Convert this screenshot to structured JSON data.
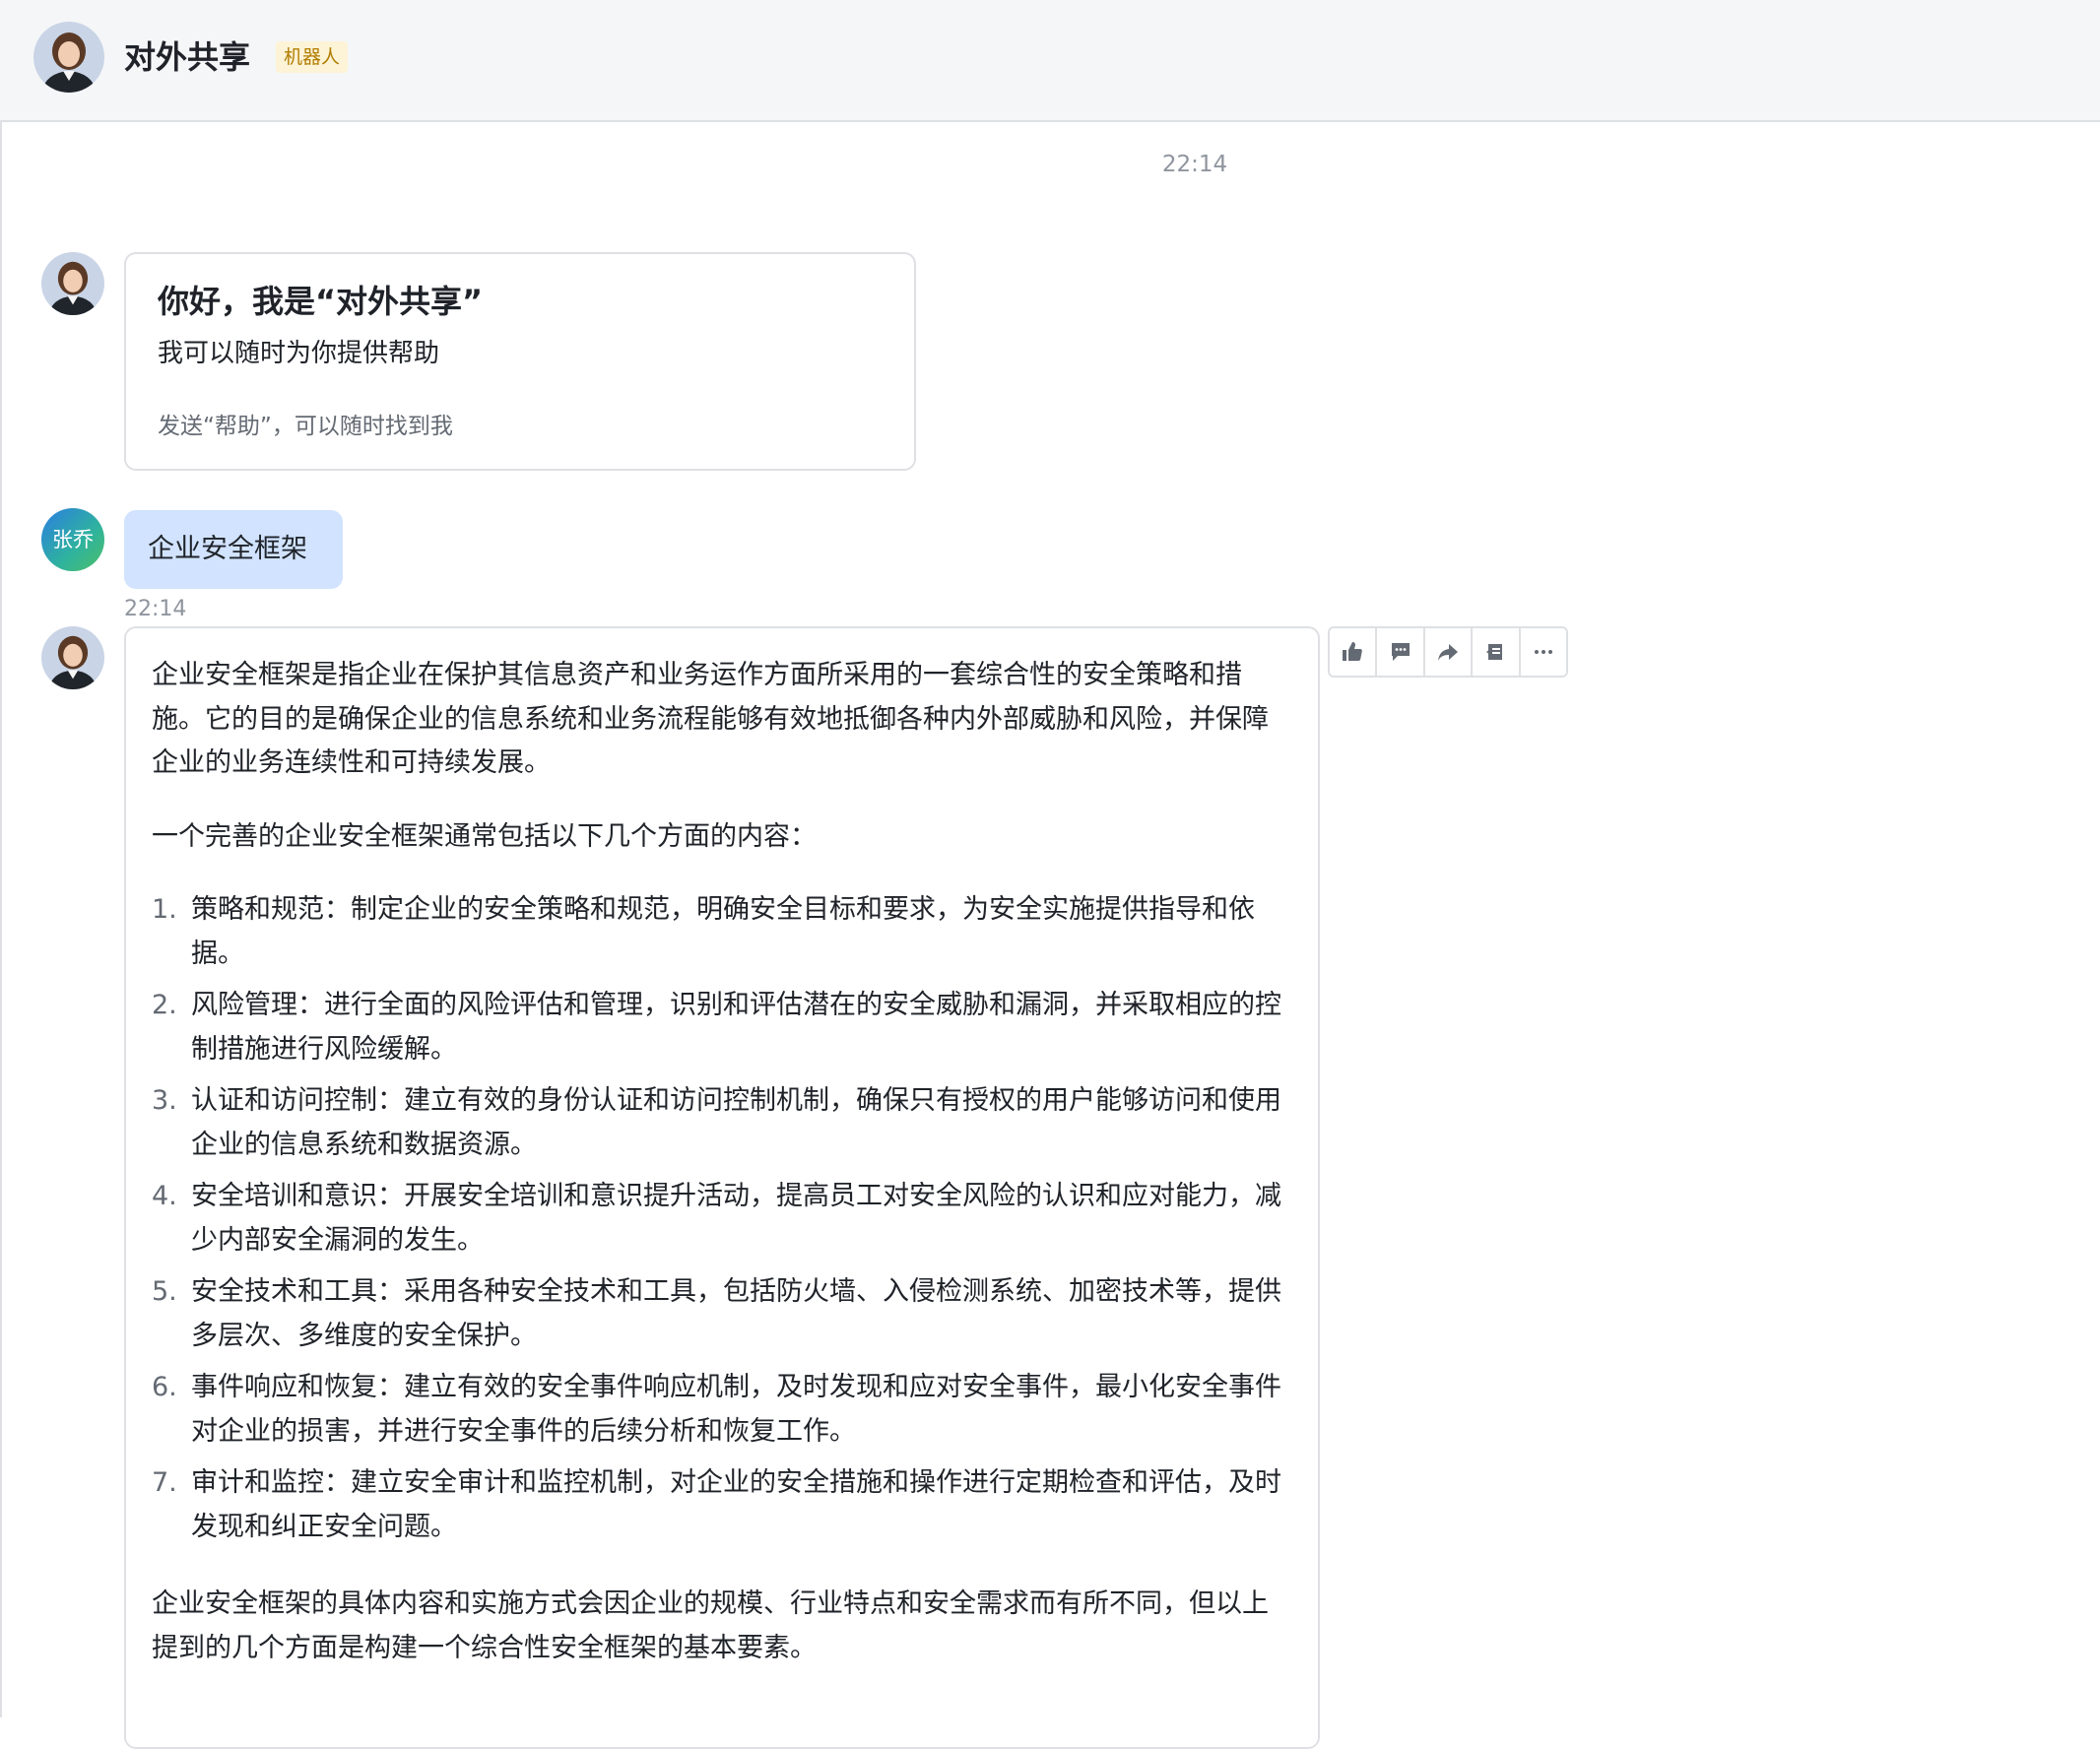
{
  "header": {
    "title": "对外共享",
    "badge": "机器人"
  },
  "messages": {
    "timestamp_top": "22:14",
    "welcome_card": {
      "title": "你好，我是“对外共享”",
      "subtitle": "我可以随时为你提供帮助",
      "hint": "发送“帮助”，可以随时找到我"
    },
    "user": {
      "avatar_text": "张乔",
      "text": "企业安全框架",
      "time": "22:14"
    },
    "answer": {
      "intro": "企业安全框架是指企业在保护其信息资产和业务运作方面所采用的一套综合性的安全策略和措施。它的目的是确保企业的信息系统和业务流程能够有效地抵御各种内外部威胁和风险，并保障企业的业务连续性和可持续发展。",
      "lead": "一个完善的企业安全框架通常包括以下几个方面的内容：",
      "items": [
        {
          "num": "1.",
          "text": "策略和规范：制定企业的安全策略和规范，明确安全目标和要求，为安全实施提供指导和依据。"
        },
        {
          "num": "2.",
          "text": "风险管理：进行全面的风险评估和管理，识别和评估潜在的安全威胁和漏洞，并采取相应的控制措施进行风险缓解。"
        },
        {
          "num": "3.",
          "text": "认证和访问控制：建立有效的身份认证和访问控制机制，确保只有授权的用户能够访问和使用企业的信息系统和数据资源。"
        },
        {
          "num": "4.",
          "text": "安全培训和意识：开展安全培训和意识提升活动，提高员工对安全风险的认识和应对能力，减少内部安全漏洞的发生。"
        },
        {
          "num": "5.",
          "text": "安全技术和工具：采用各种安全技术和工具，包括防火墙、入侵检测系统、加密技术等，提供多层次、多维度的安全保护。"
        },
        {
          "num": "6.",
          "text": "事件响应和恢复：建立有效的安全事件响应机制，及时发现和应对安全事件，最小化安全事件对企业的损害，并进行安全事件的后续分析和恢复工作。"
        },
        {
          "num": "7.",
          "text": "审计和监控：建立安全审计和监控机制，对企业的安全措施和操作进行定期检查和评估，及时发现和纠正安全问题。"
        }
      ],
      "summary": "企业安全框架的具体内容和实施方式会因企业的规模、行业特点和安全需求而有所不同，但以上提到的几个方面是构建一个综合性安全框架的基本要素。"
    }
  },
  "toolbar": {
    "icons": [
      "thumbs-up-icon",
      "comment-icon",
      "forward-icon",
      "pin-icon",
      "more-icon"
    ]
  },
  "colors": {
    "accent": "#3370ff",
    "user_bubble": "#d1e3ff",
    "badge_bg": "#fdf3d6",
    "badge_text": "#b27d00"
  }
}
